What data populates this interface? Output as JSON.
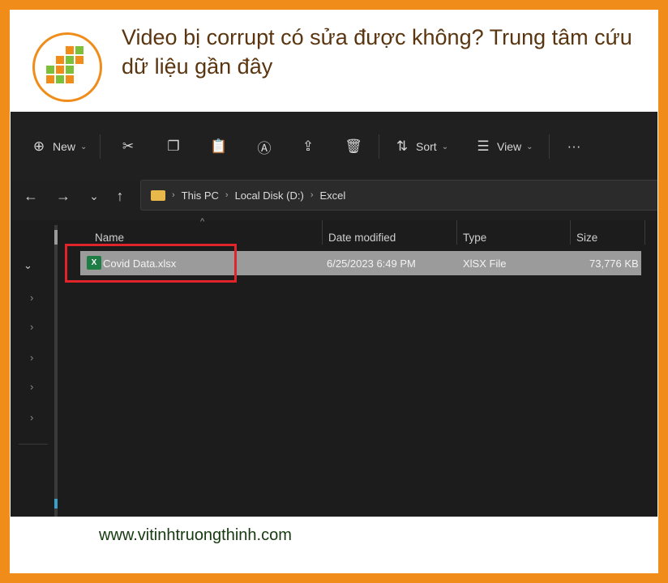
{
  "banner": {
    "headline": "Video bị corrupt có sửa được không? Trung tâm cứu dữ liệu gần đây",
    "url": "www.vitinhtruongthinh.com",
    "frame_color": "#f08c1a",
    "text_color": "#5a3510"
  },
  "explorer": {
    "toolbar": {
      "new_label": "New",
      "sort_label": "Sort",
      "view_label": "View",
      "icons": [
        "cut-icon",
        "copy-icon",
        "paste-icon",
        "rename-icon",
        "share-icon",
        "delete-icon",
        "more-icon"
      ]
    },
    "address": {
      "segments": [
        "This PC",
        "Local Disk (D:)",
        "Excel"
      ]
    },
    "columns": {
      "name": "Name",
      "date": "Date modified",
      "type": "Type",
      "size": "Size"
    },
    "files": [
      {
        "name": "Covid Data.xlsx",
        "date": "6/25/2023 6:49 PM",
        "type": "XlSX File",
        "size": "73,776 KB",
        "selected": true
      }
    ],
    "highlight_color": "#e0242a"
  }
}
